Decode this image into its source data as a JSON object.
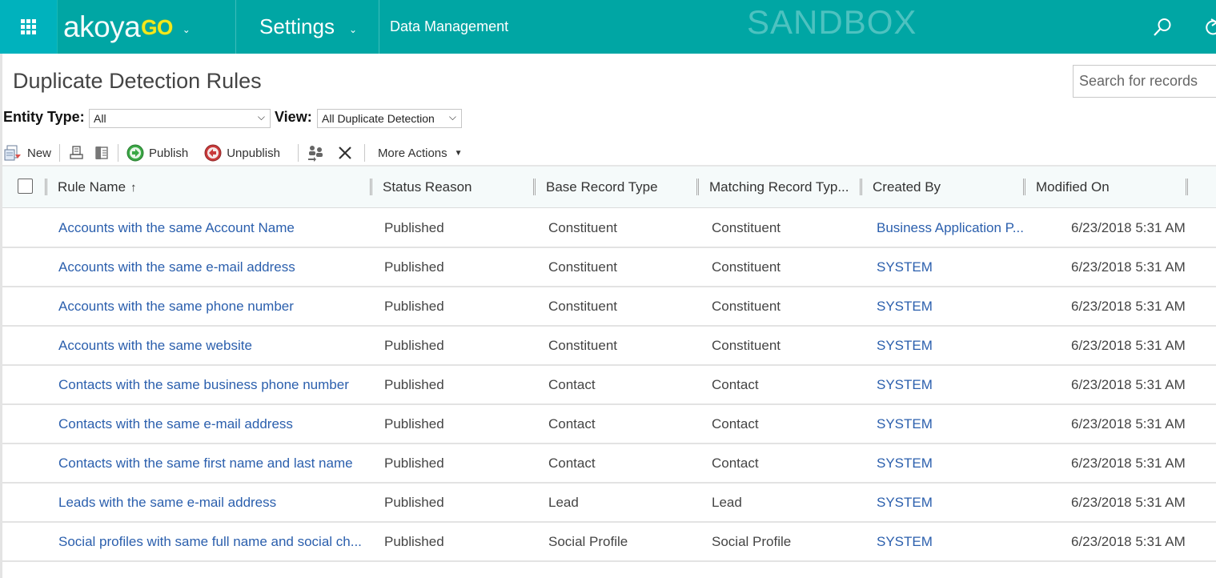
{
  "nav": {
    "app_brand_main": "akoya",
    "app_brand_accent": "GO",
    "area": "Settings",
    "breadcrumb": "Data Management",
    "environment": "SANDBOX",
    "icons": [
      "waffle-icon",
      "chevron-down-icon",
      "search-icon",
      "refresh-icon"
    ]
  },
  "page": {
    "title": "Duplicate Detection Rules",
    "search_placeholder": "Search for records"
  },
  "filters": {
    "entity_type_label": "Entity Type:",
    "entity_type_value": "All",
    "view_label": "View:",
    "view_value": "All Duplicate Detection"
  },
  "toolbar": {
    "new": "New",
    "publish": "Publish",
    "unpublish": "Unpublish",
    "more_actions": "More Actions"
  },
  "grid": {
    "columns": {
      "rule_name": "Rule Name",
      "sort_indicator": "↑",
      "status_reason": "Status Reason",
      "base_record_type": "Base Record Type",
      "matching_record_type": "Matching Record Typ...",
      "created_by": "Created By",
      "modified_on": "Modified On"
    },
    "rows": [
      {
        "name": "Accounts with the same Account Name",
        "status": "Published",
        "base": "Constituent",
        "matching": "Constituent",
        "created_by": "Business Application P...",
        "modified": "6/23/2018 5:31 AM"
      },
      {
        "name": "Accounts with the same e-mail address",
        "status": "Published",
        "base": "Constituent",
        "matching": "Constituent",
        "created_by": "SYSTEM",
        "modified": "6/23/2018 5:31 AM"
      },
      {
        "name": "Accounts with the same phone number",
        "status": "Published",
        "base": "Constituent",
        "matching": "Constituent",
        "created_by": "SYSTEM",
        "modified": "6/23/2018 5:31 AM"
      },
      {
        "name": "Accounts with the same website",
        "status": "Published",
        "base": "Constituent",
        "matching": "Constituent",
        "created_by": "SYSTEM",
        "modified": "6/23/2018 5:31 AM"
      },
      {
        "name": "Contacts with the same business phone number",
        "status": "Published",
        "base": "Contact",
        "matching": "Contact",
        "created_by": "SYSTEM",
        "modified": "6/23/2018 5:31 AM"
      },
      {
        "name": "Contacts with the same e-mail address",
        "status": "Published",
        "base": "Contact",
        "matching": "Contact",
        "created_by": "SYSTEM",
        "modified": "6/23/2018 5:31 AM"
      },
      {
        "name": "Contacts with the same first name and last name",
        "status": "Published",
        "base": "Contact",
        "matching": "Contact",
        "created_by": "SYSTEM",
        "modified": "6/23/2018 5:31 AM"
      },
      {
        "name": "Leads with the same e-mail address",
        "status": "Published",
        "base": "Lead",
        "matching": "Lead",
        "created_by": "SYSTEM",
        "modified": "6/23/2018 5:31 AM"
      },
      {
        "name": "Social profiles with same full name and social ch...",
        "status": "Published",
        "base": "Social Profile",
        "matching": "Social Profile",
        "created_by": "SYSTEM",
        "modified": "6/23/2018 5:31 AM"
      }
    ]
  },
  "colors": {
    "nav_bg": "#00a6a4",
    "waffle_bg": "#00b2bd",
    "brand_accent": "#f3e81c",
    "link": "#2b5fad",
    "header_bg": "#f5fafa"
  }
}
